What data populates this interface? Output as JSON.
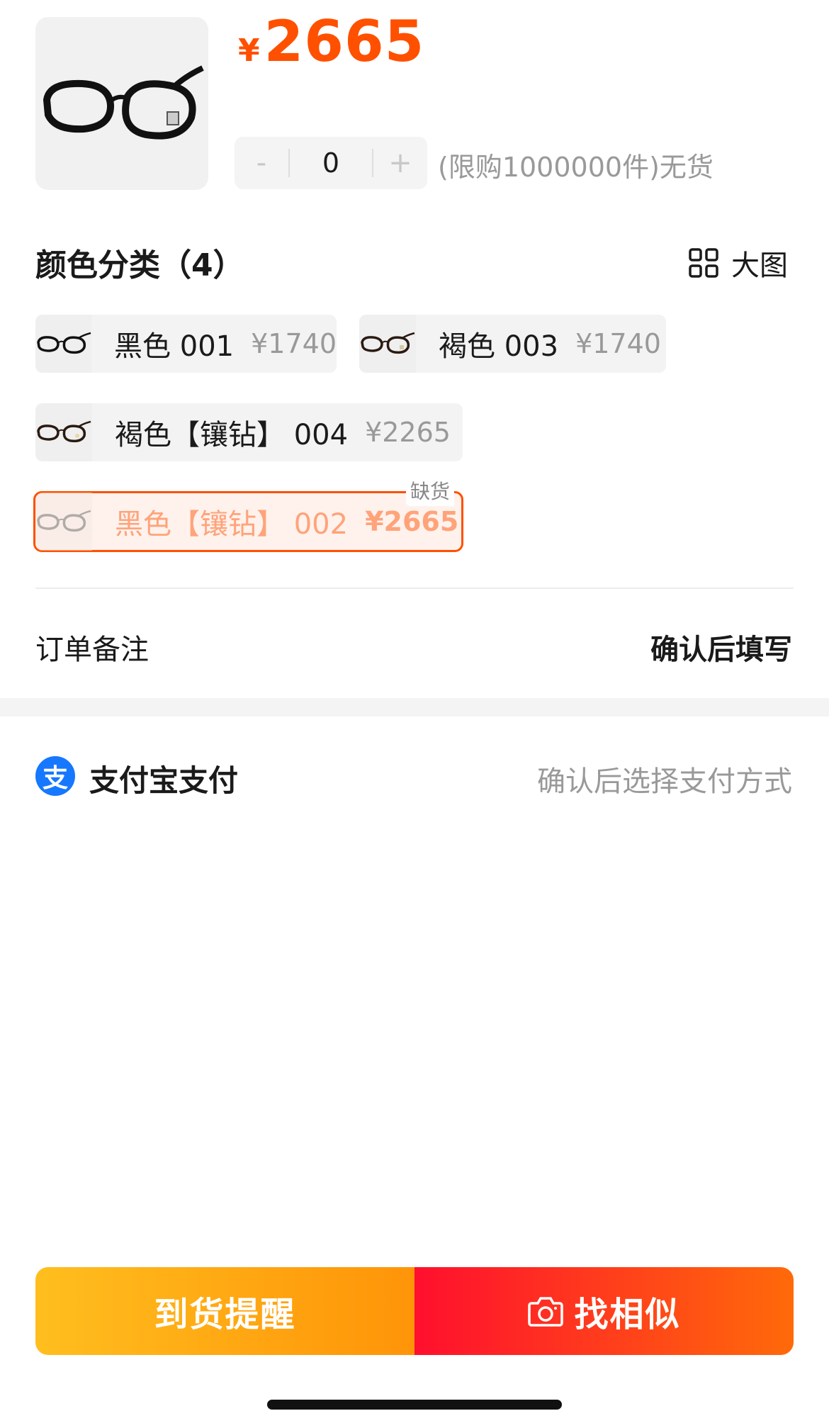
{
  "product": {
    "currency_symbol": "¥",
    "price": "2665",
    "quantity": "0",
    "minus_label": "-",
    "plus_label": "+",
    "limit_text": "(限购1000000件)无货",
    "image_icon": "glasses-icon"
  },
  "color_section": {
    "title": "颜色分类（4）",
    "big_view_label": "大图",
    "big_view_icon": "grid-icon",
    "options": [
      {
        "name": "黑色 001",
        "price": "¥1740",
        "selected": false
      },
      {
        "name": "褐色 003",
        "price": "¥1740",
        "selected": false
      },
      {
        "name": "褐色【镶钻】 004",
        "price": "¥2265",
        "selected": false
      },
      {
        "name": "黑色【镶钻】 002",
        "price": "¥2665",
        "selected": true,
        "badge": "缺货"
      }
    ]
  },
  "remark": {
    "label": "订单备注",
    "value": "确认后填写"
  },
  "payment": {
    "icon_char": "支",
    "label": "支付宝支付",
    "hint": "确认后选择支付方式"
  },
  "actions": {
    "notify_label": "到货提醒",
    "similar_label": "找相似",
    "similar_icon": "camera-icon"
  },
  "colors": {
    "accent": "#ff5000",
    "notify_start": "#ffbe1e",
    "notify_end": "#ff9408",
    "similar_start": "#ff0f2e",
    "similar_end": "#ff6a0a",
    "alipay_blue": "#1677ff"
  }
}
